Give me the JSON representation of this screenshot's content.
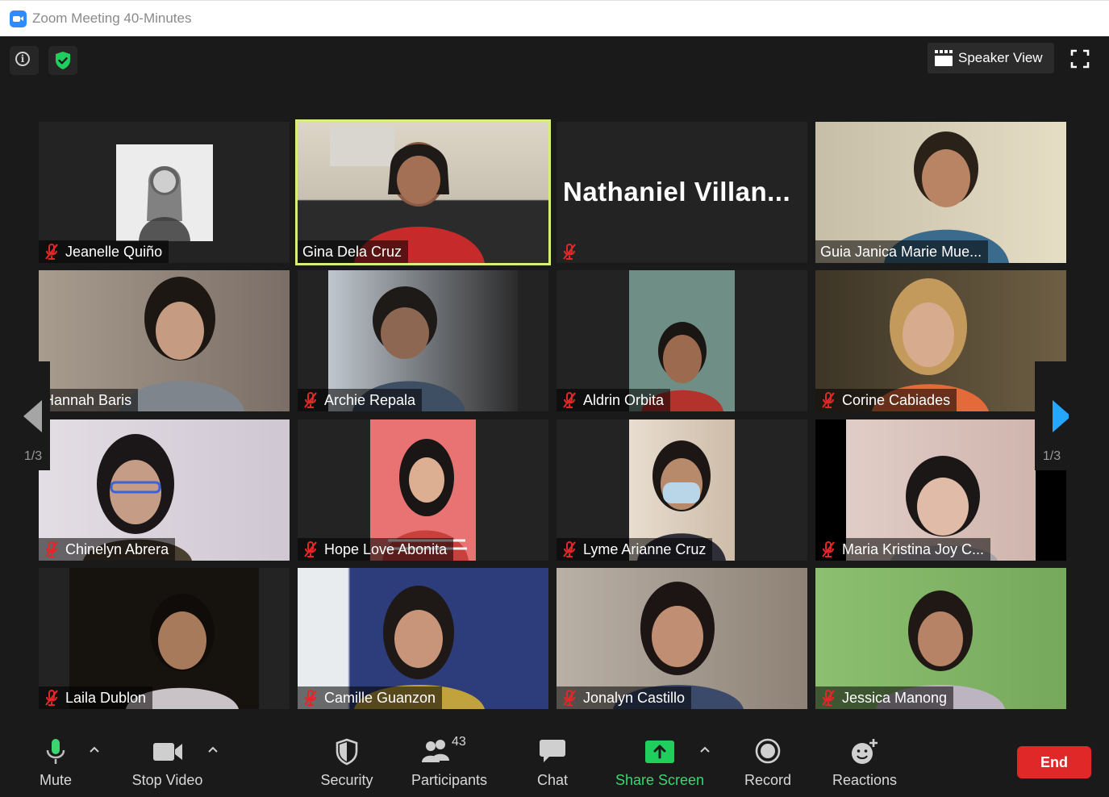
{
  "window": {
    "title": "Zoom Meeting 40-Minutes"
  },
  "header": {
    "view_label": "Speaker View"
  },
  "gallery": {
    "page_left": "1/3",
    "page_right": "1/3",
    "tiles": [
      {
        "name": "Jeanelle Quiño",
        "bg": "#f0f0f0"
      },
      {
        "name": "Gina Dela Cruz",
        "bg": "#b53a3a"
      },
      {
        "name": "Nathaniel  Villan...",
        "bg": "#232323"
      },
      {
        "name": "Guia Janica Marie Mue...",
        "bg": "#c9c0a8"
      },
      {
        "name": "Hannah Baris",
        "bg": "#8d8a86"
      },
      {
        "name": "Archie Repala",
        "bg": "#5d6a78"
      },
      {
        "name": "Aldrin Orbita",
        "bg": "#6f8e86"
      },
      {
        "name": "Corine Cabiades",
        "bg": "#6e5f44"
      },
      {
        "name": "Chinelyn Abrera",
        "bg": "#d7d1d8"
      },
      {
        "name": "Hope Love Abonita",
        "bg": "#e97373"
      },
      {
        "name": "Lyme Arianne Cruz",
        "bg": "#d9c9b4"
      },
      {
        "name": "Maria Kristina Joy C...",
        "bg": "#d9c2bc"
      },
      {
        "name": "Laila Dublon",
        "bg": "#2a2620"
      },
      {
        "name": "Camille Guanzon",
        "bg": "#2d3c7a"
      },
      {
        "name": "Jonalyn Castillo",
        "bg": "#a89d91"
      },
      {
        "name": "Jessica Manong",
        "bg": "#83b66c"
      }
    ]
  },
  "toolbar": {
    "mute": "Mute",
    "stop_video": "Stop Video",
    "security": "Security",
    "participants": "Participants",
    "participant_count": "43",
    "chat": "Chat",
    "share_screen": "Share Screen",
    "record": "Record",
    "reactions": "Reactions",
    "end": "End"
  },
  "colors": {
    "accent_green": "#3bd671",
    "active_speaker": "#d7ef7a",
    "end_red": "#e02828",
    "mute_red": "#e02828"
  }
}
